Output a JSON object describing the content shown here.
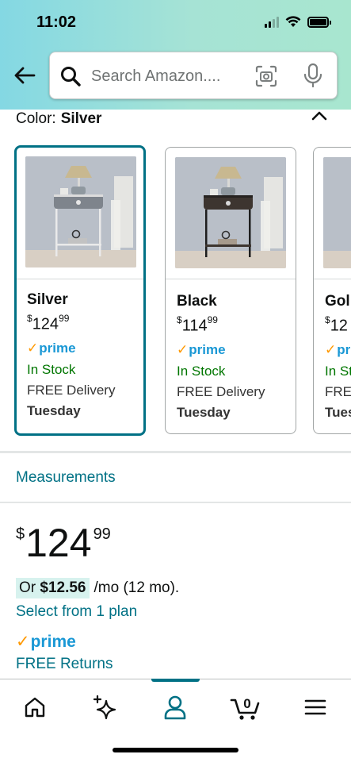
{
  "status": {
    "time": "11:02"
  },
  "search": {
    "placeholder": "Search Amazon...."
  },
  "color_selector": {
    "label": "Color:",
    "selected": "Silver"
  },
  "swatches": [
    {
      "name": "Silver",
      "price_whole": "124",
      "price_frac": "99",
      "prime": "prime",
      "stock": "In Stock",
      "delivery": "FREE Delivery",
      "day": "Tuesday",
      "selected": true
    },
    {
      "name": "Black",
      "price_whole": "114",
      "price_frac": "99",
      "prime": "prime",
      "stock": "In Stock",
      "delivery": "FREE Delivery",
      "day": "Tuesday",
      "selected": false
    },
    {
      "name": "Gol",
      "price_whole": "12",
      "price_frac": "",
      "prime": "pri",
      "stock": "In St",
      "delivery": "FREE",
      "day": "Tues",
      "selected": false
    }
  ],
  "currency_symbol": "$",
  "measurements_link": "Measurements",
  "price": {
    "whole": "124",
    "frac": "99"
  },
  "financing": {
    "prefix": "Or",
    "amount": "$12.56",
    "suffix": "/mo (12 mo)."
  },
  "plan_link": "Select from 1 plan",
  "prime_label": "prime",
  "returns_link": "FREE Returns",
  "cart_count": "0",
  "colors": {
    "accent": "#007185",
    "prime_blue": "#1a98d5",
    "prime_check": "#ff9900",
    "stock_green": "#007600",
    "header_gradient": "#84d8e3"
  },
  "nav_icons": [
    "home-icon",
    "sparkle-icon",
    "account-icon",
    "cart-icon",
    "menu-icon"
  ]
}
